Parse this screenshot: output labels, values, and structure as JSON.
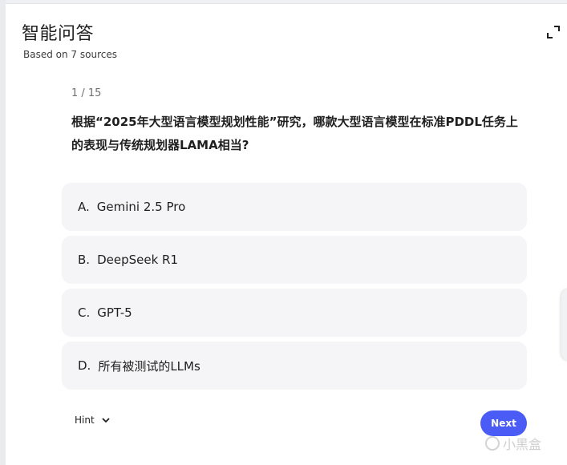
{
  "header": {
    "title": "智能问答",
    "subtitle": "Based on 7 sources",
    "expand_icon": "expand-icon"
  },
  "quiz": {
    "counter": "1 / 15",
    "question": "根据“2025年大型语言模型规划性能”研究，哪款大型语言模型在标准PDDL任务上的表现与传统规划器LAMA相当?",
    "options": [
      {
        "letter": "A.",
        "text": "Gemini 2.5 Pro"
      },
      {
        "letter": "B.",
        "text": "DeepSeek R1"
      },
      {
        "letter": "C.",
        "text": "GPT-5"
      },
      {
        "letter": "D.",
        "text": "所有被测试的LLMs"
      }
    ]
  },
  "footer": {
    "hint_label": "Hint",
    "next_label": "Next",
    "next_color": "#4a5cf5"
  },
  "watermark": {
    "text": "小黑盒"
  }
}
